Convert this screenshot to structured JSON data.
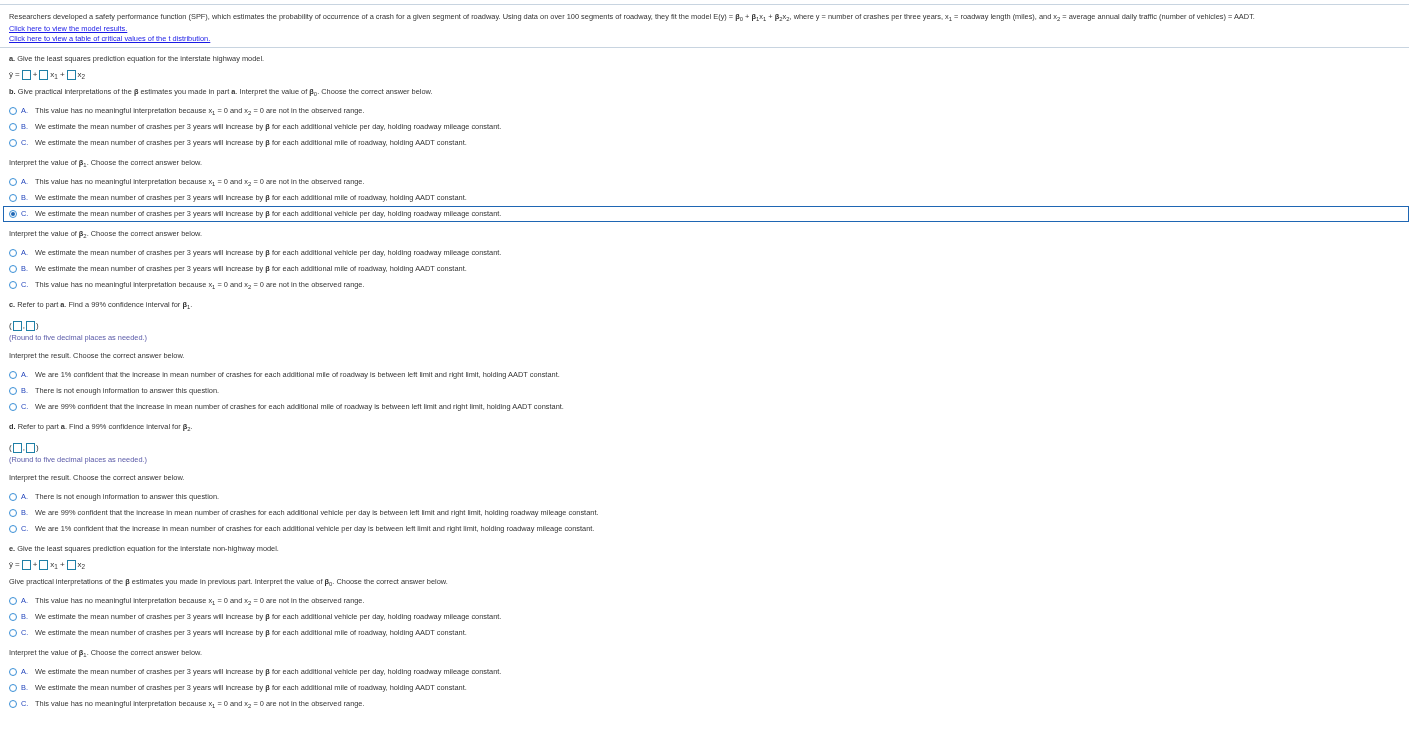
{
  "intro": "Researchers developed a safety performance function (SPF), which estimates the probability of occurrence of a crash for a given segment of roadway. Using data on over 100 segments of roadway, they fit the model E(y) = **β**$_{0}$ + **β**$_{1}$x$_{1}$ + **β**$_{2}$x$_{2}$, where y = number of crashes per three years, x$_{1}$ = roadway  length (miles), and x$_{2}$ = average annual daily traffic (number of vehicles)  = AADT.",
  "links": [
    "Click here to view the model results.",
    "Click here to view a table of critical values of the t distribution."
  ],
  "blocks": [
    {
      "kind": "prompt",
      "text": "**a.** Give the least squares prediction equation for the interstate highway model."
    },
    {
      "kind": "equation",
      "tokens": [
        {
          "kind": "symbol",
          "text": "ŷ"
        },
        {
          "kind": "symbol",
          "text": "="
        },
        {
          "kind": "box"
        },
        {
          "kind": "symbol",
          "text": "+"
        },
        {
          "kind": "box"
        },
        {
          "kind": "symbol",
          "text": "x$_{1}$"
        },
        {
          "kind": "symbol",
          "text": "+"
        },
        {
          "kind": "box"
        },
        {
          "kind": "symbol",
          "text": "x$_{2}$"
        }
      ]
    },
    {
      "kind": "prompt",
      "text": "**b.** Give practical interpretations of the **β** estimates you made in part **a**. Interpret the value of **β**$_{0}$. Choose the correct answer below."
    },
    {
      "kind": "choices",
      "options": [
        {
          "letter": "A.",
          "text": "This value has no meaningful interpretation because  x$_{1}$ = 0 and x$_{2}$ = 0 are not in the observed range.",
          "selected": false
        },
        {
          "letter": "B.",
          "text": "We estimate the mean number of crashes per 3 years will increase by **β** for each additional vehicle per day, holding roadway mileage constant.",
          "selected": false
        },
        {
          "letter": "C.",
          "text": "We estimate the mean number of crashes per 3 years will increase by **β** for each additional mile of roadway, holding AADT constant.",
          "selected": false
        }
      ]
    },
    {
      "kind": "prompt",
      "text": "Interpret the value of **β**$_{1}$. Choose the correct answer below."
    },
    {
      "kind": "choices",
      "options": [
        {
          "letter": "A.",
          "text": "This value has no meaningful interpretation because  x$_{1}$ = 0 and x$_{2}$ = 0 are not in the observed range.",
          "selected": false
        },
        {
          "letter": "B.",
          "text": "We estimate the mean number of crashes per 3 years will increase by **β** for each additional mile of roadway, holding AADT constant.",
          "selected": false
        },
        {
          "letter": "C.",
          "text": "We estimate the mean number of crashes per 3 years will increase by **β** for each additional vehicle per day, holding roadway mileage constant.",
          "selected": true
        }
      ]
    },
    {
      "kind": "prompt",
      "text": "Interpret the value of **β**$_{2}$. Choose the correct answer below."
    },
    {
      "kind": "choices",
      "options": [
        {
          "letter": "A.",
          "text": "We estimate the mean number of crashes per 3 years will increase by **β** for each additional vehicle per day, holding roadway mileage constant.",
          "selected": false
        },
        {
          "letter": "B.",
          "text": "We estimate the mean number of crashes per 3 years will increase by **β** for each additional mile of roadway, holding AADT constant.",
          "selected": false
        },
        {
          "letter": "C.",
          "text": "This value has no meaningful interpretation because  x$_{1}$ = 0 and x$_{2}$ = 0 are not in the observed range.",
          "selected": false
        }
      ]
    },
    {
      "kind": "prompt",
      "text": "**c.** Refer to part **a**. Find a 99% confidence interval for **β**$_{1}$."
    },
    {
      "kind": "interval",
      "tokens": [
        {
          "kind": "symbol",
          "text": "("
        },
        {
          "kind": "box"
        },
        {
          "kind": "symbol",
          "text": ","
        },
        {
          "kind": "box"
        },
        {
          "kind": "symbol",
          "text": ")"
        }
      ]
    },
    {
      "kind": "note",
      "text": "(Round to five decimal places as needed.)"
    },
    {
      "kind": "prompt",
      "text": "Interpret the result. Choose the correct answer below."
    },
    {
      "kind": "choices",
      "options": [
        {
          "letter": "A.",
          "text": "We are 1% confident that the increase in mean number of crashes for each additional mile of roadway is between left limit and right limit, holding AADT constant.",
          "selected": false
        },
        {
          "letter": "B.",
          "text": "There is not enough information to answer this question.",
          "selected": false
        },
        {
          "letter": "C.",
          "text": "We are 99% confident that the increase in mean number of crashes for each additional  mile of roadway is between left limit and right limit, holding AADT constant.",
          "selected": false
        }
      ]
    },
    {
      "kind": "prompt",
      "text": "**d.** Refer to part **a**. Find a 99% confidence interval for **β**$_{2}$."
    },
    {
      "kind": "interval",
      "tokens": [
        {
          "kind": "symbol",
          "text": "("
        },
        {
          "kind": "box"
        },
        {
          "kind": "symbol",
          "text": ","
        },
        {
          "kind": "box"
        },
        {
          "kind": "symbol",
          "text": ")"
        }
      ]
    },
    {
      "kind": "note",
      "text": "(Round to five decimal places as needed.)"
    },
    {
      "kind": "prompt",
      "text": "Interpret the result. Choose the correct answer below."
    },
    {
      "kind": "choices",
      "options": [
        {
          "letter": "A.",
          "text": "There is not enough information to answer this question.",
          "selected": false
        },
        {
          "letter": "B.",
          "text": "We are 99% confident that the increase in mean number of crashes for each additional vehicle per day is between left limit and right limit, holding roadway mileage constant.",
          "selected": false
        },
        {
          "letter": "C.",
          "text": "We are 1% confident that the increase in mean number of crashes for each additional vehicle per day is between left limit and right limit, holding roadway mileage constant.",
          "selected": false
        }
      ]
    },
    {
      "kind": "prompt",
      "text": "**e.** Give the least squares prediction equation for the interstate non-highway model."
    },
    {
      "kind": "equation",
      "tokens": [
        {
          "kind": "symbol",
          "text": "ŷ"
        },
        {
          "kind": "symbol",
          "text": "="
        },
        {
          "kind": "box"
        },
        {
          "kind": "symbol",
          "text": "+"
        },
        {
          "kind": "box"
        },
        {
          "kind": "symbol",
          "text": "x$_{1}$"
        },
        {
          "kind": "symbol",
          "text": "+"
        },
        {
          "kind": "box"
        },
        {
          "kind": "symbol",
          "text": "x$_{2}$"
        }
      ]
    },
    {
      "kind": "prompt",
      "text": "Give practical interpretations of the **β** estimates you made in previous part. Interpret the value of **β**$_{0}$. Choose the correct answer below."
    },
    {
      "kind": "choices",
      "options": [
        {
          "letter": "A.",
          "text": "This value has no meaningful interpretation because  x$_{1}$ = 0 and x$_{2}$ = 0 are not in the observed range.",
          "selected": false
        },
        {
          "letter": "B.",
          "text": "We estimate the mean number of crashes per 3 years will increase by **β** for each additional vehicle per day, holding roadway mileage constant.",
          "selected": false
        },
        {
          "letter": "C.",
          "text": "We estimate the mean number of crashes per 3 years will increase by **β** for each additional mile of roadway, holding AADT constant.",
          "selected": false
        }
      ]
    },
    {
      "kind": "prompt",
      "text": "Interpret the value of **β**$_{1}$. Choose the correct answer below."
    },
    {
      "kind": "choices",
      "options": [
        {
          "letter": "A.",
          "text": "We estimate the mean number of crashes per 3 years will increase by **β** for each additional vehicle per day, holding roadway mileage constant.",
          "selected": false
        },
        {
          "letter": "B.",
          "text": "We estimate the mean number of crashes per 3 years will increase by **β** for each additional mile of roadway, holding AADT constant.",
          "selected": false
        },
        {
          "letter": "C.",
          "text": "This value has no meaningful interpretation because  x$_{1}$ = 0 and x$_{2}$ = 0 are not in the observed range.",
          "selected": false
        }
      ]
    }
  ]
}
